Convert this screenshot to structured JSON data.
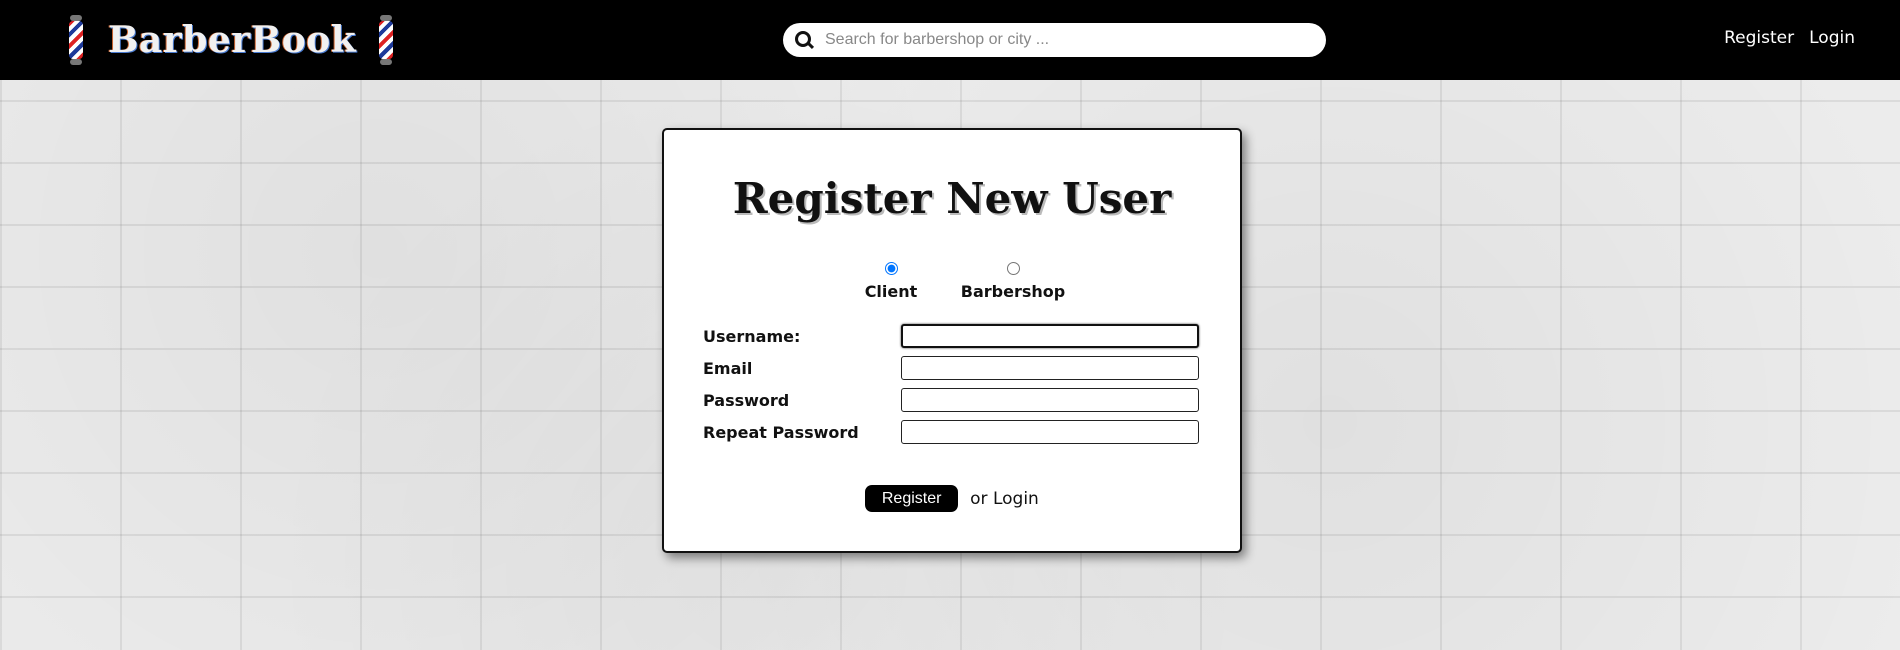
{
  "header": {
    "brand": "BarberBook",
    "search_placeholder": "Search for barbershop or city ...",
    "nav": {
      "register": "Register",
      "login": "Login"
    }
  },
  "form": {
    "title": "Register New User",
    "account_types": {
      "client": "Client",
      "barbershop": "Barbershop",
      "selected": "Client"
    },
    "fields": {
      "username": "Username:",
      "email": "Email",
      "password": "Password",
      "repeat_password": "Repeat Password"
    },
    "submit_label": "Register",
    "or_text": "or",
    "login_link": "Login"
  }
}
